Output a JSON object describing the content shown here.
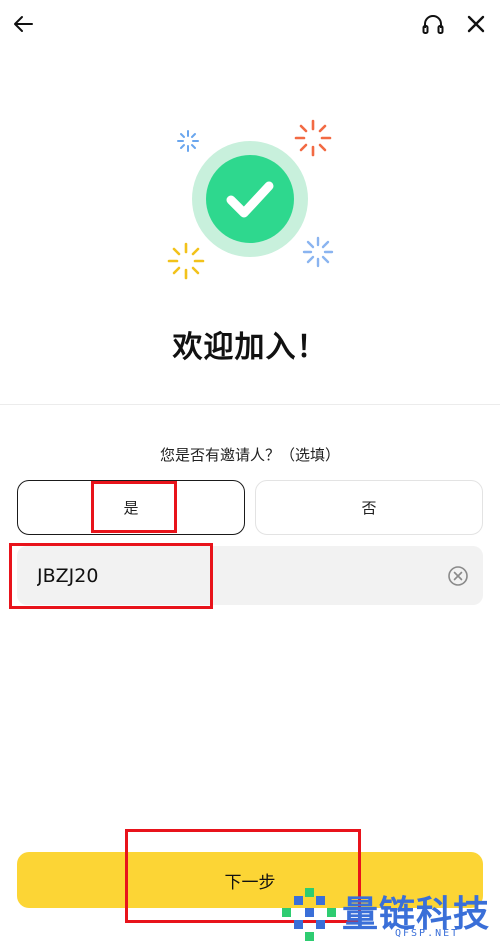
{
  "header": {
    "back_icon": "arrow-left-icon",
    "support_icon": "headset-icon",
    "close_icon": "close-icon"
  },
  "welcome": {
    "title": "欢迎加入！",
    "icon": "check-circle-icon"
  },
  "invite": {
    "question": "您是否有邀请人？（选填）",
    "yes_label": "是",
    "no_label": "否",
    "selected": "是",
    "input_value": "JBZJ20",
    "clear_icon": "clear-circle-icon"
  },
  "next_label": "下一步",
  "colors": {
    "accent": "#fcd535",
    "success": "#2ed88e",
    "annotation": "#e8131b"
  },
  "watermark": {
    "text": "量链科技",
    "sub": "QFSP.NET"
  }
}
